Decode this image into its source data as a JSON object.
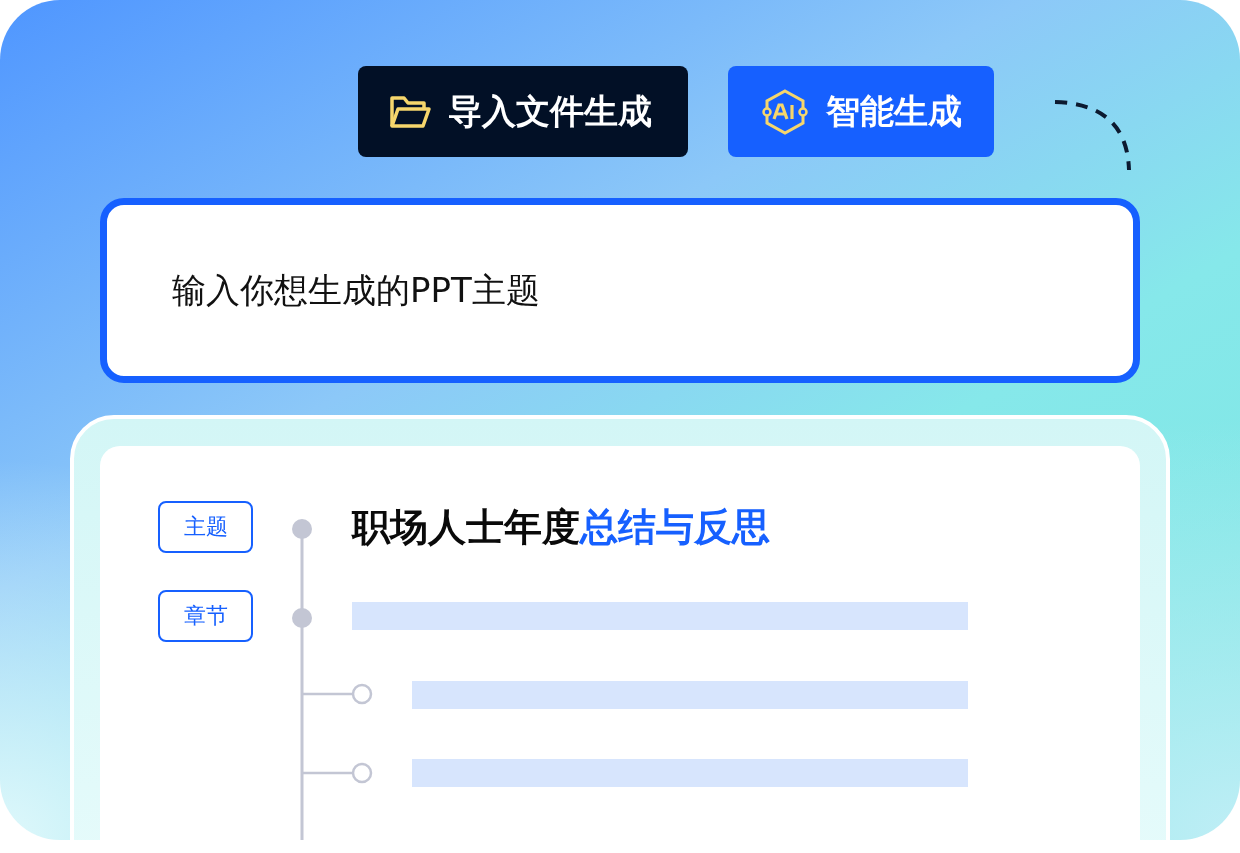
{
  "buttons": [
    {
      "kind": "folder",
      "label": "导入文件生成",
      "selected": false
    },
    {
      "kind": "ai",
      "label": "智能生成",
      "selected": true
    }
  ],
  "topic_field": {
    "value": "输入你想生成的PPT主题"
  },
  "outline": [
    {
      "kind": "topic",
      "tag": "主题",
      "title": "职场人士年度",
      "highlight": "总结与反思"
    },
    {
      "kind": "chapter",
      "tag": "章节",
      "children": [
        {
          "kind": "skeleton"
        },
        {
          "kind": "skeleton"
        }
      ]
    }
  ]
}
